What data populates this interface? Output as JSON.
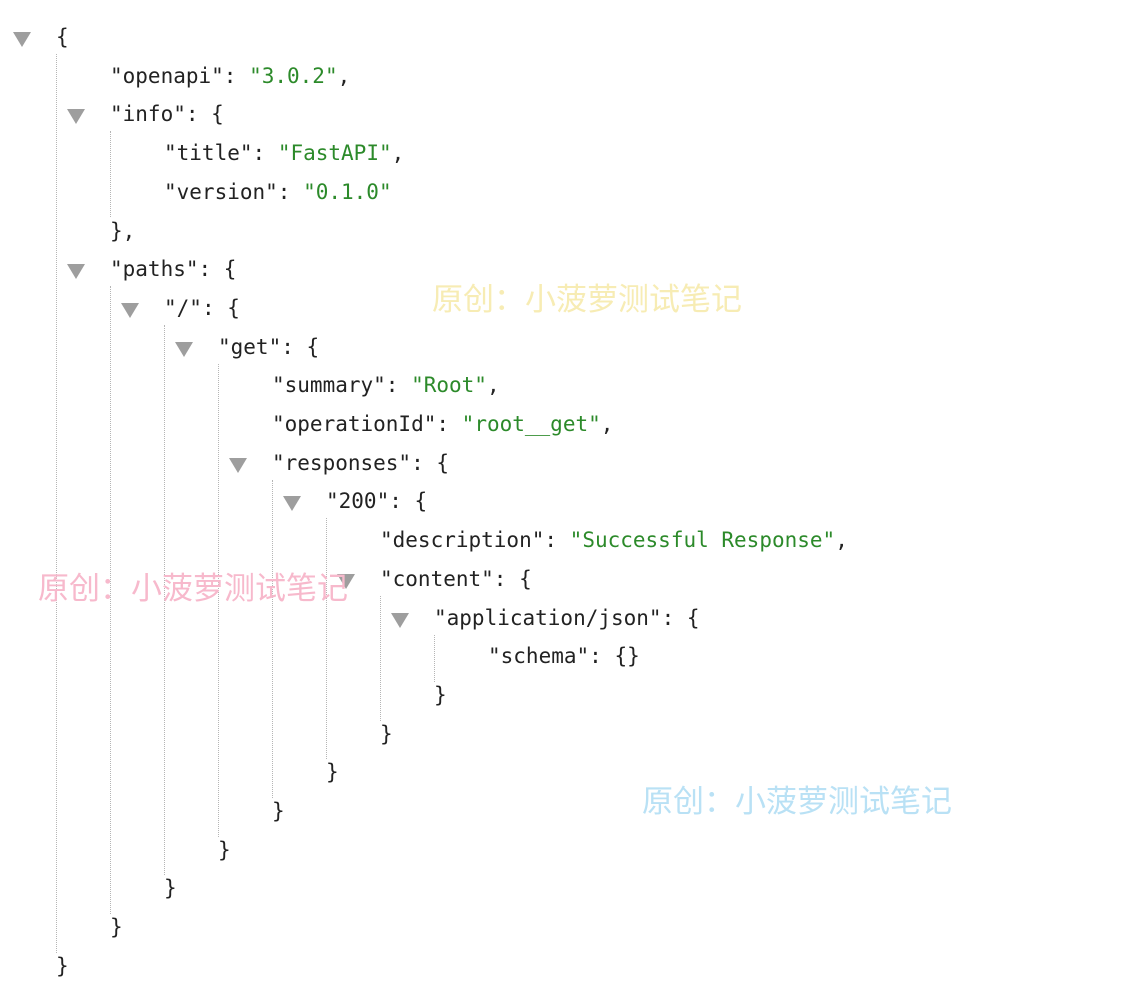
{
  "json_viewer": {
    "lines": [
      {
        "depth": 0,
        "collapsible": true,
        "name": "root",
        "tokens": [
          {
            "t": "{",
            "c": "p"
          }
        ]
      },
      {
        "depth": 1,
        "collapsible": false,
        "name": "openapi",
        "tokens": [
          {
            "t": "\"openapi\"",
            "c": "k"
          },
          {
            "t": ": ",
            "c": "p"
          },
          {
            "t": "\"3.0.2\"",
            "c": "s"
          },
          {
            "t": ",",
            "c": "p"
          }
        ]
      },
      {
        "depth": 1,
        "collapsible": true,
        "name": "info",
        "tokens": [
          {
            "t": "\"info\"",
            "c": "k"
          },
          {
            "t": ": {",
            "c": "p"
          }
        ]
      },
      {
        "depth": 2,
        "collapsible": false,
        "name": "title",
        "tokens": [
          {
            "t": "\"title\"",
            "c": "k"
          },
          {
            "t": ": ",
            "c": "p"
          },
          {
            "t": "\"FastAPI\"",
            "c": "s"
          },
          {
            "t": ",",
            "c": "p"
          }
        ]
      },
      {
        "depth": 2,
        "collapsible": false,
        "name": "version",
        "tokens": [
          {
            "t": "\"version\"",
            "c": "k"
          },
          {
            "t": ": ",
            "c": "p"
          },
          {
            "t": "\"0.1.0\"",
            "c": "s"
          }
        ]
      },
      {
        "depth": 1,
        "collapsible": false,
        "name": "info-close",
        "tokens": [
          {
            "t": "},",
            "c": "p"
          }
        ]
      },
      {
        "depth": 1,
        "collapsible": true,
        "name": "paths",
        "tokens": [
          {
            "t": "\"paths\"",
            "c": "k"
          },
          {
            "t": ": {",
            "c": "p"
          }
        ]
      },
      {
        "depth": 2,
        "collapsible": true,
        "name": "path-root",
        "tokens": [
          {
            "t": "\"/\"",
            "c": "k"
          },
          {
            "t": ": {",
            "c": "p"
          }
        ]
      },
      {
        "depth": 3,
        "collapsible": true,
        "name": "get",
        "tokens": [
          {
            "t": "\"get\"",
            "c": "k"
          },
          {
            "t": ": {",
            "c": "p"
          }
        ]
      },
      {
        "depth": 4,
        "collapsible": false,
        "name": "summary",
        "tokens": [
          {
            "t": "\"summary\"",
            "c": "k"
          },
          {
            "t": ": ",
            "c": "p"
          },
          {
            "t": "\"Root\"",
            "c": "s"
          },
          {
            "t": ",",
            "c": "p"
          }
        ]
      },
      {
        "depth": 4,
        "collapsible": false,
        "name": "operation-id",
        "tokens": [
          {
            "t": "\"operationId\"",
            "c": "k"
          },
          {
            "t": ": ",
            "c": "p"
          },
          {
            "t": "\"root__get\"",
            "c": "s"
          },
          {
            "t": ",",
            "c": "p"
          }
        ]
      },
      {
        "depth": 4,
        "collapsible": true,
        "name": "responses",
        "tokens": [
          {
            "t": "\"responses\"",
            "c": "k"
          },
          {
            "t": ": {",
            "c": "p"
          }
        ]
      },
      {
        "depth": 5,
        "collapsible": true,
        "name": "status-200",
        "tokens": [
          {
            "t": "\"200\"",
            "c": "k"
          },
          {
            "t": ": {",
            "c": "p"
          }
        ]
      },
      {
        "depth": 6,
        "collapsible": false,
        "name": "description",
        "tokens": [
          {
            "t": "\"description\"",
            "c": "k"
          },
          {
            "t": ": ",
            "c": "p"
          },
          {
            "t": "\"Successful Response\"",
            "c": "s"
          },
          {
            "t": ",",
            "c": "p"
          }
        ]
      },
      {
        "depth": 6,
        "collapsible": true,
        "name": "content",
        "tokens": [
          {
            "t": "\"content\"",
            "c": "k"
          },
          {
            "t": ": {",
            "c": "p"
          }
        ]
      },
      {
        "depth": 7,
        "collapsible": true,
        "name": "application-json",
        "tokens": [
          {
            "t": "\"application/json\"",
            "c": "k"
          },
          {
            "t": ": {",
            "c": "p"
          }
        ]
      },
      {
        "depth": 8,
        "collapsible": false,
        "name": "schema",
        "tokens": [
          {
            "t": "\"schema\"",
            "c": "k"
          },
          {
            "t": ": {}",
            "c": "p"
          }
        ]
      },
      {
        "depth": 7,
        "collapsible": false,
        "name": "application-json-close",
        "tokens": [
          {
            "t": "}",
            "c": "p"
          }
        ]
      },
      {
        "depth": 6,
        "collapsible": false,
        "name": "content-close",
        "tokens": [
          {
            "t": "}",
            "c": "p"
          }
        ]
      },
      {
        "depth": 5,
        "collapsible": false,
        "name": "status-200-close",
        "tokens": [
          {
            "t": "}",
            "c": "p"
          }
        ]
      },
      {
        "depth": 4,
        "collapsible": false,
        "name": "responses-close",
        "tokens": [
          {
            "t": "}",
            "c": "p"
          }
        ]
      },
      {
        "depth": 3,
        "collapsible": false,
        "name": "get-close",
        "tokens": [
          {
            "t": "}",
            "c": "p"
          }
        ]
      },
      {
        "depth": 2,
        "collapsible": false,
        "name": "path-root-close",
        "tokens": [
          {
            "t": "}",
            "c": "p"
          }
        ]
      },
      {
        "depth": 1,
        "collapsible": false,
        "name": "paths-close",
        "tokens": [
          {
            "t": "}",
            "c": "p"
          }
        ]
      },
      {
        "depth": 0,
        "collapsible": false,
        "name": "root-close",
        "tokens": [
          {
            "t": "}",
            "c": "p"
          }
        ]
      }
    ]
  },
  "watermarks": [
    {
      "text": "原创：小菠萝测试笔记",
      "color": "#f7ecb4"
    },
    {
      "text": "原创：小菠萝测试笔记",
      "color": "#f7b9cc"
    },
    {
      "text": "原创：小菠萝测试笔记",
      "color": "#b9e1f5"
    }
  ],
  "colors": {
    "key": "#222222",
    "string": "#2c8a2a",
    "punctuation": "#222222",
    "toggle": "#9e9e9e",
    "guide": "#b5b5b5"
  }
}
